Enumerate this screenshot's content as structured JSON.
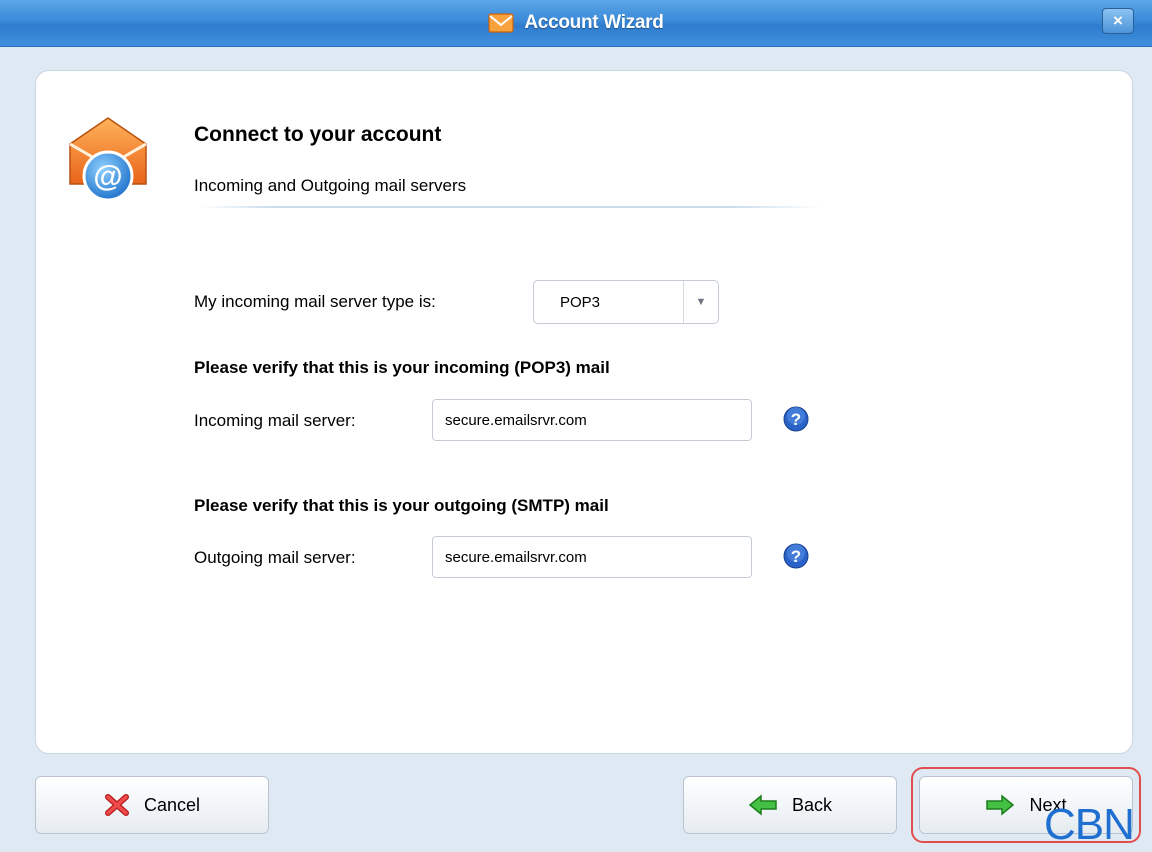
{
  "window": {
    "title": "Account Wizard",
    "close_label": "×"
  },
  "header": {
    "title": "Connect to your account",
    "subtitle": "Incoming and Outgoing mail servers"
  },
  "form": {
    "server_type_label": "My incoming mail server type is:",
    "server_type_value": "POP3",
    "incoming_heading": "Please verify that this is your incoming (POP3) mail",
    "incoming_label": "Incoming mail server:",
    "incoming_value": "secure.emailsrvr.com",
    "outgoing_heading": "Please verify that this is your outgoing (SMTP) mail",
    "outgoing_label": "Outgoing mail server:",
    "outgoing_value": "secure.emailsrvr.com"
  },
  "buttons": {
    "cancel": "Cancel",
    "back": "Back",
    "next": "Next"
  },
  "watermark": "CBN",
  "icons": {
    "title": "envelope-icon",
    "hero": "email-at-icon",
    "help": "help-icon",
    "cancel": "red-x-icon",
    "back": "green-arrow-left-icon",
    "next": "green-arrow-right-icon"
  },
  "colors": {
    "titlebar": "#3b8ad8",
    "highlight_ring": "#e14e4e",
    "watermark": "#1f6fd0"
  }
}
